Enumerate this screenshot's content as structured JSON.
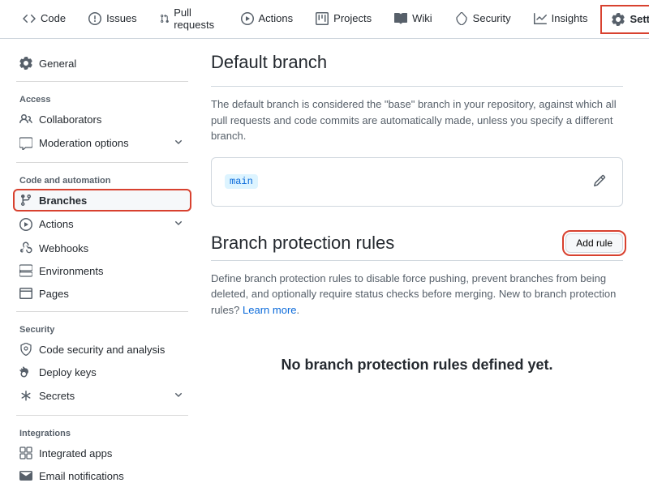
{
  "topnav": [
    {
      "label": "Code",
      "icon": "code"
    },
    {
      "label": "Issues",
      "icon": "issue"
    },
    {
      "label": "Pull requests",
      "icon": "pr"
    },
    {
      "label": "Actions",
      "icon": "play"
    },
    {
      "label": "Projects",
      "icon": "project"
    },
    {
      "label": "Wiki",
      "icon": "book"
    },
    {
      "label": "Security",
      "icon": "shield"
    },
    {
      "label": "Insights",
      "icon": "graph"
    },
    {
      "label": "Settings",
      "icon": "gear",
      "selected": true,
      "highlighted": true
    }
  ],
  "sidebar": {
    "general": {
      "label": "General"
    },
    "groups": [
      {
        "heading": "Access",
        "items": [
          {
            "label": "Collaborators",
            "icon": "people"
          },
          {
            "label": "Moderation options",
            "icon": "comment",
            "chevron": true
          }
        ]
      },
      {
        "heading": "Code and automation",
        "items": [
          {
            "label": "Branches",
            "icon": "branch",
            "active": true,
            "highlighted": true
          },
          {
            "label": "Actions",
            "icon": "play",
            "chevron": true
          },
          {
            "label": "Webhooks",
            "icon": "webhook"
          },
          {
            "label": "Environments",
            "icon": "server"
          },
          {
            "label": "Pages",
            "icon": "browser"
          }
        ]
      },
      {
        "heading": "Security",
        "items": [
          {
            "label": "Code security and analysis",
            "icon": "shield-search"
          },
          {
            "label": "Deploy keys",
            "icon": "key"
          },
          {
            "label": "Secrets",
            "icon": "asterisk",
            "chevron": true
          }
        ]
      },
      {
        "heading": "Integrations",
        "items": [
          {
            "label": "Integrated apps",
            "icon": "apps"
          },
          {
            "label": "Email notifications",
            "icon": "mail"
          }
        ]
      }
    ]
  },
  "main": {
    "default_branch": {
      "title": "Default branch",
      "desc": "The default branch is considered the \"base\" branch in your repository, against which all pull requests and code commits are automatically made, unless you specify a different branch.",
      "branch_name": "main"
    },
    "protection": {
      "title": "Branch protection rules",
      "add_rule": "Add rule",
      "desc_prefix": "Define branch protection rules to disable force pushing, prevent branches from being deleted, and optionally require status checks before merging. New to branch protection rules? ",
      "learn_more": "Learn more",
      "desc_suffix": ".",
      "empty": "No branch protection rules defined yet."
    }
  }
}
